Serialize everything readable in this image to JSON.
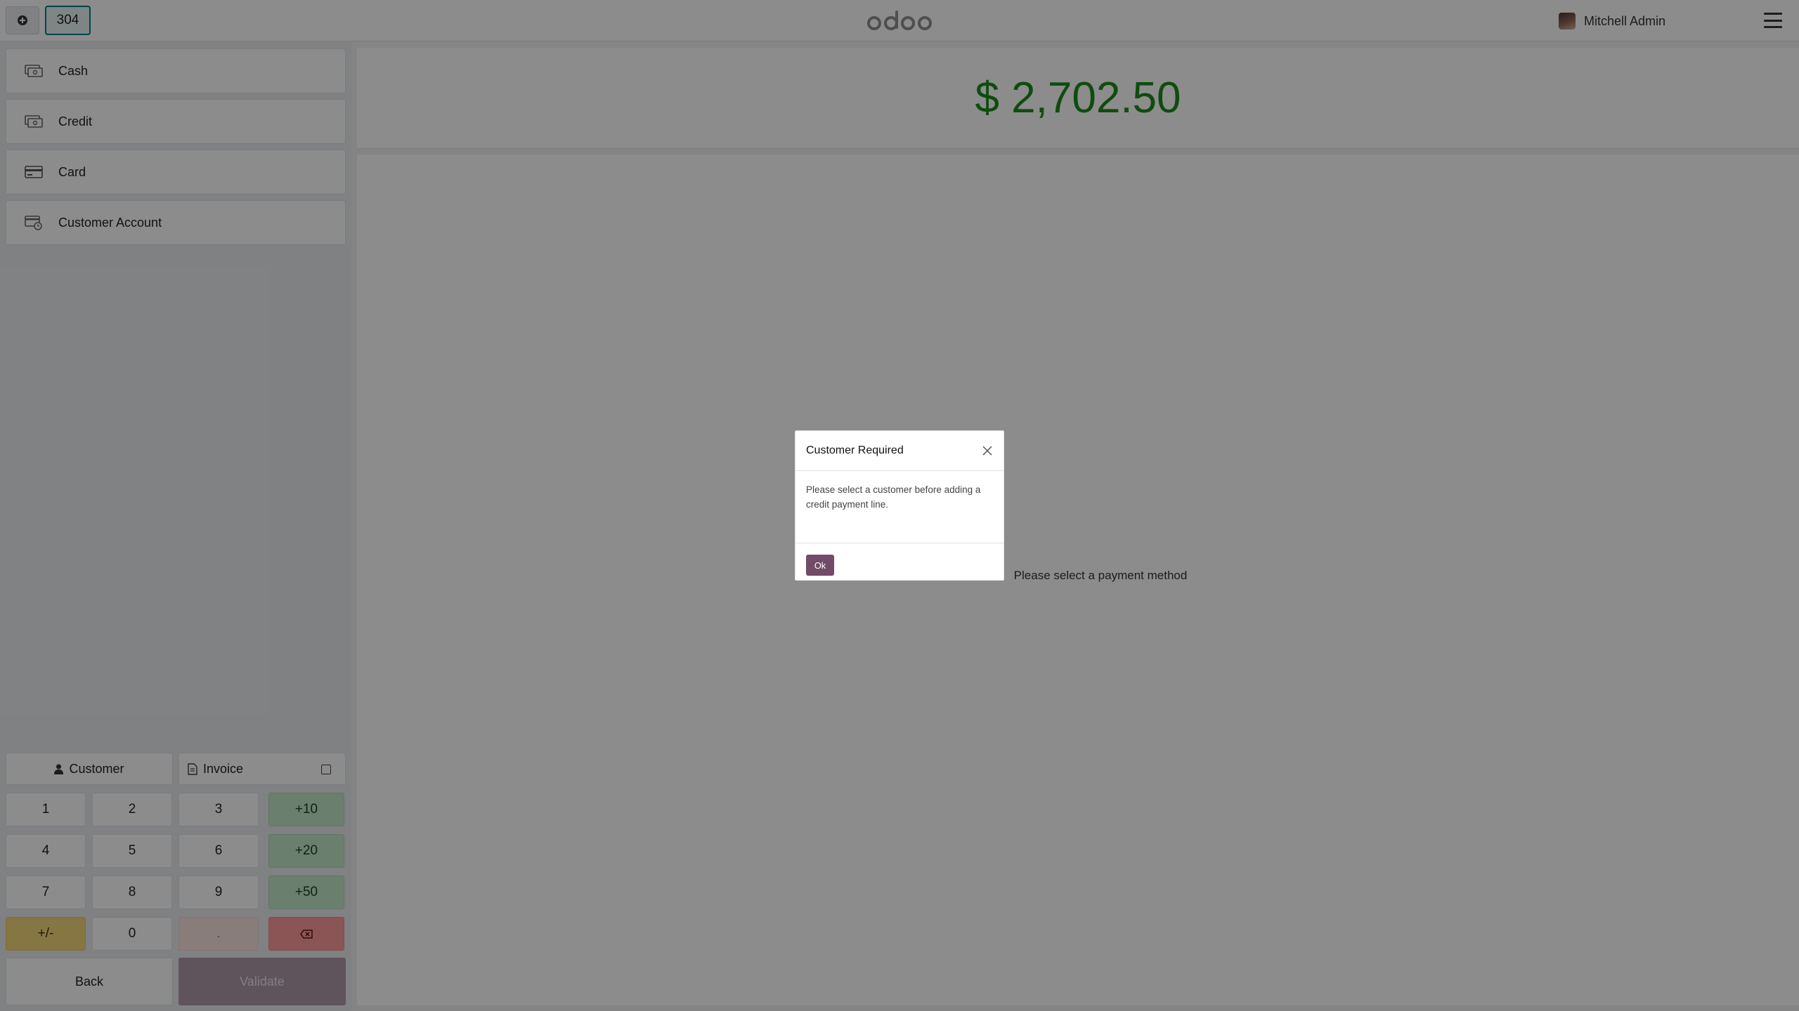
{
  "topbar": {
    "order_number": "304",
    "logo_text": "odoo",
    "user_name": "Mitchell Admin"
  },
  "payment_methods": [
    {
      "label": "Cash",
      "icon": "cash-icon"
    },
    {
      "label": "Credit",
      "icon": "cash-icon"
    },
    {
      "label": "Card",
      "icon": "credit-card-icon"
    },
    {
      "label": "Customer Account",
      "icon": "wallet-icon"
    }
  ],
  "actions": {
    "customer_label": "Customer",
    "invoice_label": "Invoice"
  },
  "numpad": {
    "keys": [
      "1",
      "2",
      "3",
      "+10",
      "4",
      "5",
      "6",
      "+20",
      "7",
      "8",
      "9",
      "+50",
      "+/-",
      "0",
      ".",
      "⌫"
    ]
  },
  "footer": {
    "back_label": "Back",
    "validate_label": "Validate"
  },
  "payment": {
    "total": "$ 2,702.50",
    "hint": "Please select a payment method"
  },
  "dialog": {
    "title": "Customer Required",
    "message": "Please select a customer before adding a credit payment line.",
    "ok_label": "Ok"
  },
  "colors": {
    "brand": "#714b67",
    "total_text": "#1c8a1c",
    "validate_disabled": "#ad9aa8"
  }
}
